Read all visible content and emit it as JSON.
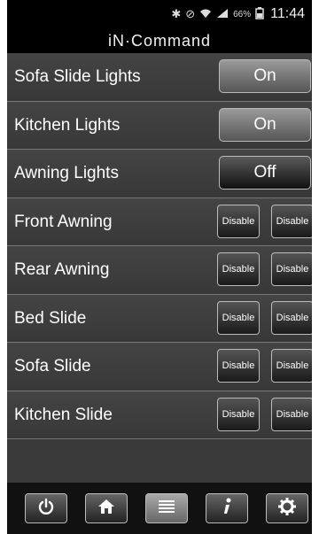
{
  "status_bar": {
    "battery": "66%",
    "time": "11:44"
  },
  "app": {
    "title": "iN·Command"
  },
  "rows": [
    {
      "label": "Sofa Slide Lights",
      "toggle": "On"
    },
    {
      "label": "Kitchen Lights",
      "toggle": "On"
    },
    {
      "label": "Awning Lights",
      "toggle": "Off"
    },
    {
      "label": "Front Awning",
      "btn1": "Disable",
      "btn2": "Disable"
    },
    {
      "label": "Rear Awning",
      "btn1": "Disable",
      "btn2": "Disable"
    },
    {
      "label": "Bed Slide",
      "btn1": "Disable",
      "btn2": "Disable"
    },
    {
      "label": "Sofa Slide",
      "btn1": "Disable",
      "btn2": "Disable"
    },
    {
      "label": "Kitchen Slide",
      "btn1": "Disable",
      "btn2": "Disable"
    }
  ],
  "bottom_nav": [
    {
      "icon": "power-icon",
      "active": false
    },
    {
      "icon": "home-icon",
      "active": false
    },
    {
      "icon": "list-icon",
      "active": true
    },
    {
      "icon": "info-icon",
      "active": false
    },
    {
      "icon": "gear-icon",
      "active": false
    }
  ]
}
